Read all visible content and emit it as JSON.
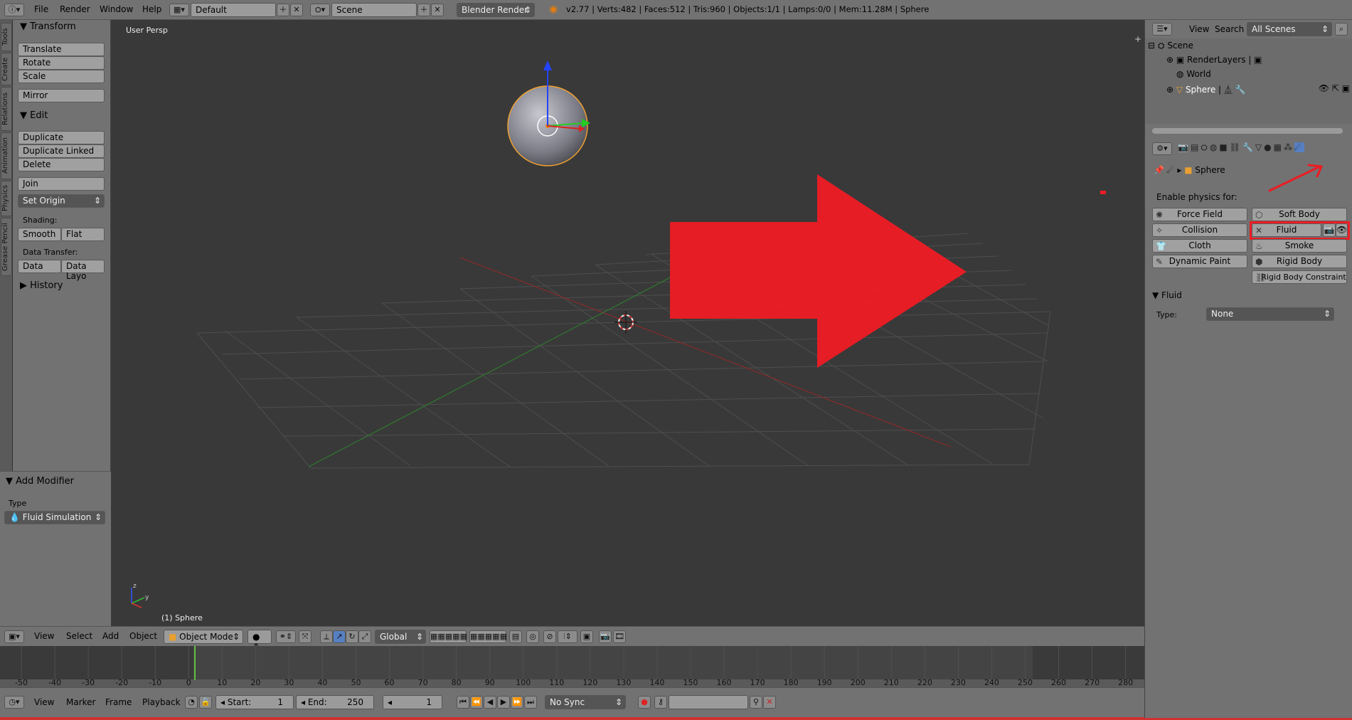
{
  "topbar": {
    "menus": [
      "File",
      "Render",
      "Window",
      "Help"
    ],
    "layout": "Default",
    "scene": "Scene",
    "engine": "Blender Render",
    "stats": "v2.77 | Verts:482 | Faces:512 | Tris:960 | Objects:1/1 | Lamps:0/0 | Mem:11.28M | Sphere"
  },
  "vtabs": [
    "Tools",
    "Create",
    "Relations",
    "Animation",
    "Physics",
    "Grease Pencil"
  ],
  "toolshelf": {
    "transform_title": "Transform",
    "transform_buttons": [
      "Translate",
      "Rotate",
      "Scale"
    ],
    "mirror": "Mirror",
    "edit_title": "Edit",
    "edit_buttons": [
      "Duplicate",
      "Duplicate Linked",
      "Delete"
    ],
    "join": "Join",
    "set_origin": "Set Origin",
    "shading_label": "Shading:",
    "smooth": "Smooth",
    "flat": "Flat",
    "data_transfer_label": "Data Transfer:",
    "data": "Data",
    "data_layout": "Data Layo",
    "history_title": "History",
    "add_modifier_title": "Add Modifier",
    "type_label": "Type",
    "type_value": "Fluid Simulation"
  },
  "viewport": {
    "view_label": "User Persp",
    "object_label": "(1) Sphere"
  },
  "vpheader": {
    "menus": [
      "View",
      "Select",
      "Add",
      "Object"
    ],
    "mode": "Object Mode",
    "orientation": "Global"
  },
  "timeline": {
    "ticks": [
      "-50",
      "-40",
      "-30",
      "-20",
      "-10",
      "0",
      "10",
      "20",
      "30",
      "40",
      "50",
      "60",
      "70",
      "80",
      "90",
      "100",
      "110",
      "120",
      "130",
      "140",
      "150",
      "160",
      "170",
      "180",
      "190",
      "200",
      "210",
      "220",
      "230",
      "240",
      "250",
      "260",
      "270",
      "280"
    ],
    "current_frame": 0
  },
  "timebar": {
    "menus": [
      "View",
      "Marker",
      "Frame",
      "Playback"
    ],
    "start_label": "Start:",
    "start_value": "1",
    "end_label": "End:",
    "end_value": "250",
    "frame_value": "1",
    "sync": "No Sync"
  },
  "outliner": {
    "menus": [
      "View",
      "Search"
    ],
    "filter": "All Scenes",
    "items": [
      "Scene",
      "RenderLayers",
      "World",
      "Sphere"
    ]
  },
  "properties": {
    "breadcrumb_object": "Sphere",
    "enable_label": "Enable physics for:",
    "left_buttons": [
      "Force Field",
      "Collision",
      "Cloth",
      "Dynamic Paint"
    ],
    "right_buttons": [
      "Soft Body",
      "Fluid",
      "Smoke",
      "Rigid Body",
      "Rigid Body Constraint"
    ],
    "fluid_panel_title": "Fluid",
    "type_label": "Type:",
    "type_value": "None"
  },
  "colors": {
    "annotation_red": "#ed1c24",
    "ui_gray": "#727272",
    "viewport_bg": "#393939"
  }
}
